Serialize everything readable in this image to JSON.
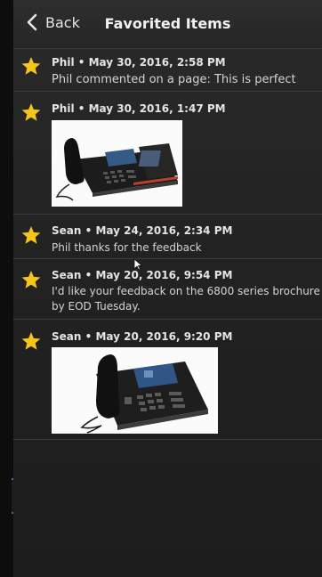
{
  "navbar": {
    "back_label": "Back",
    "title": "Favorited Items"
  },
  "items": [
    {
      "meta": "Phil • May 30, 2016, 2:58 PM",
      "text": "Phil commented on a page: This is perfect"
    },
    {
      "meta": "Phil • May 30, 2016, 1:47 PM",
      "attachment": "desk-phone-with-expansion-module-image"
    },
    {
      "meta": "Sean • May 24, 2016, 2:34 PM",
      "text": "Phil thanks for the feedback"
    },
    {
      "meta": "Sean • May 20, 2016, 9:54 PM",
      "text_line1": "I'd like your feedback on the 6800 series brochure",
      "text_line2": "by EOD Tuesday."
    },
    {
      "meta": "Sean • May 20, 2016, 9:20 PM",
      "attachment": "desk-phone-image"
    }
  ],
  "colors": {
    "star": "#f5c518",
    "background": "#222222",
    "accent_handle": "#3b6fb6"
  }
}
